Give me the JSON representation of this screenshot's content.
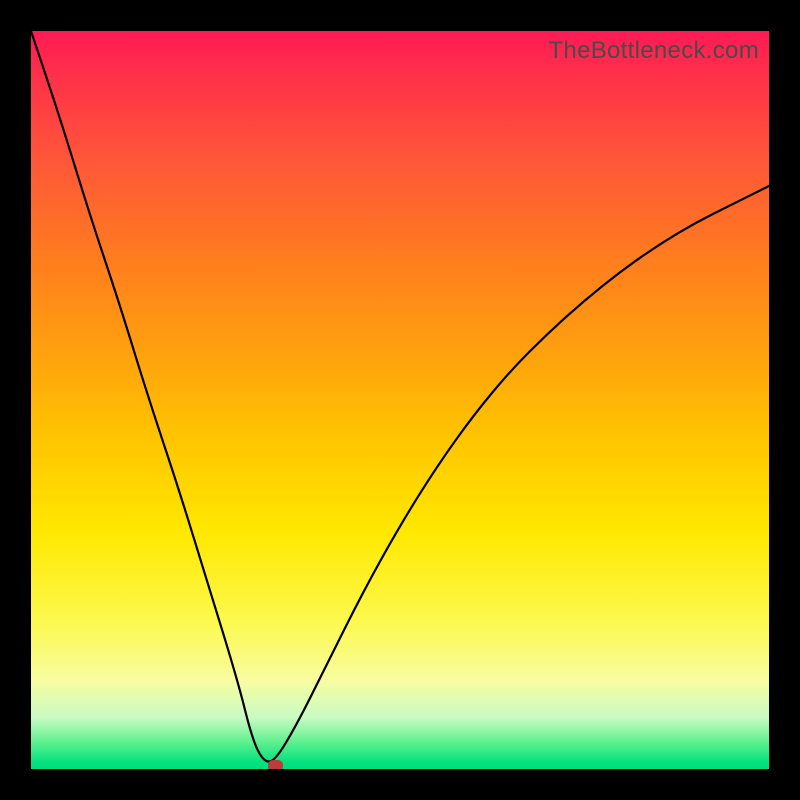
{
  "watermark": "TheBottleneck.com",
  "colors": {
    "frame": "#000000",
    "curve": "#000000",
    "marker": "#bd3b3b",
    "gradient_top": "#ff1a55",
    "gradient_bottom": "#00dc7c"
  },
  "chart_data": {
    "type": "line",
    "title": "",
    "xlabel": "",
    "ylabel": "",
    "xlim": [
      0,
      100
    ],
    "ylim": [
      0,
      100
    ],
    "grid": false,
    "legend": null,
    "series": [
      {
        "name": "bottleneck-curve",
        "x": [
          0,
          4,
          8,
          12,
          16,
          20,
          24,
          28,
          30,
          31.5,
          33,
          36,
          40,
          45,
          50,
          55,
          60,
          65,
          70,
          75,
          80,
          85,
          90,
          95,
          100
        ],
        "y": [
          100,
          88,
          75,
          63,
          50,
          38,
          25,
          12,
          4,
          1,
          1,
          6,
          14,
          24,
          33,
          41,
          48,
          54,
          59,
          63.5,
          67.5,
          71,
          74,
          76.5,
          79
        ]
      }
    ],
    "annotations": [
      {
        "name": "optimal-marker",
        "x": 33,
        "y": 0.5
      }
    ]
  }
}
